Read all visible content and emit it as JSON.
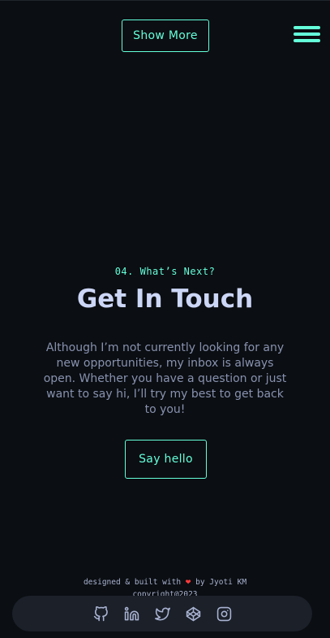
{
  "header": {
    "show_more_label": "Show More",
    "menu_icon": "hamburger-menu-icon"
  },
  "contact": {
    "overline": "04. What’s Next?",
    "title": "Get In Touch",
    "body": "Although I’m not currently looking for any new opportunities, my inbox is always open. Whether you have a question or just want to say hi, I’ll try my best to get back to you!",
    "cta_label": "Say hello"
  },
  "footer": {
    "credit_prefix": "designed & built with",
    "heart": "❤",
    "credit_suffix": "by Jyoti KM",
    "copyright": "copyright@2023",
    "social_icons": [
      "github-icon",
      "linkedin-icon",
      "twitter-icon",
      "codepen-icon",
      "instagram-icon"
    ]
  },
  "colors": {
    "background": "#0b0e12",
    "accent": "#64ffda",
    "heading": "#ccd6f6",
    "body_text": "#8892b0",
    "social_bar": "#1b2029",
    "heart": "#ff3b3b"
  }
}
